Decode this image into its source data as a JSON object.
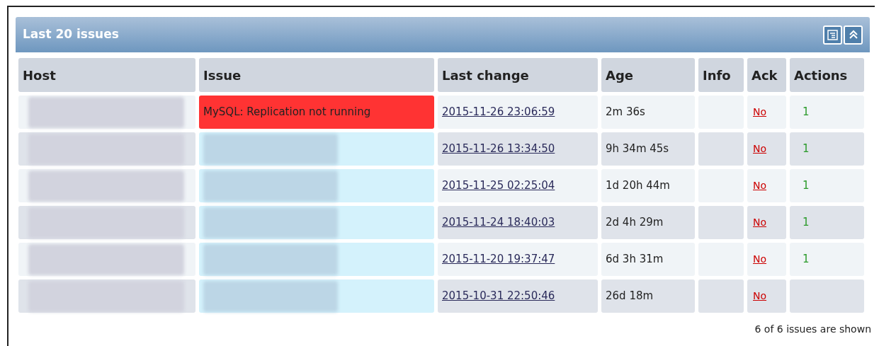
{
  "widget": {
    "title": "Last 20 issues"
  },
  "table": {
    "columns": [
      "Host",
      "Issue",
      "Last change",
      "Age",
      "Info",
      "Ack",
      "Actions"
    ],
    "rows": [
      {
        "issue": "MySQL: Replication not running",
        "issue_redacted": false,
        "color": "#ff3333",
        "last_change": "2015-11-26 23:06:59",
        "age": "2m 36s",
        "ack": "No",
        "actions": "1"
      },
      {
        "issue_redacted": true,
        "color": "#d4f2fc",
        "last_change": "2015-11-26 13:34:50",
        "age": "9h 34m 45s",
        "ack": "No",
        "actions": "1"
      },
      {
        "issue_redacted": true,
        "color": "#d4f2fc",
        "last_change": "2015-11-25 02:25:04",
        "age": "1d 20h 44m",
        "ack": "No",
        "actions": "1"
      },
      {
        "issue_redacted": true,
        "color": "#d4f2fc",
        "last_change": "2015-11-24 18:40:03",
        "age": "2d 4h 29m",
        "ack": "No",
        "actions": "1"
      },
      {
        "issue_redacted": true,
        "color": "#d4f2fc",
        "last_change": "2015-11-20 19:37:47",
        "age": "6d 3h 31m",
        "ack": "No",
        "actions": "1"
      },
      {
        "issue_redacted": true,
        "color": "#d4f2fc",
        "last_change": "2015-10-31 22:50:46",
        "age": "26d 18m",
        "ack": "No"
      }
    ]
  },
  "footer": "6 of 6 issues are shown"
}
